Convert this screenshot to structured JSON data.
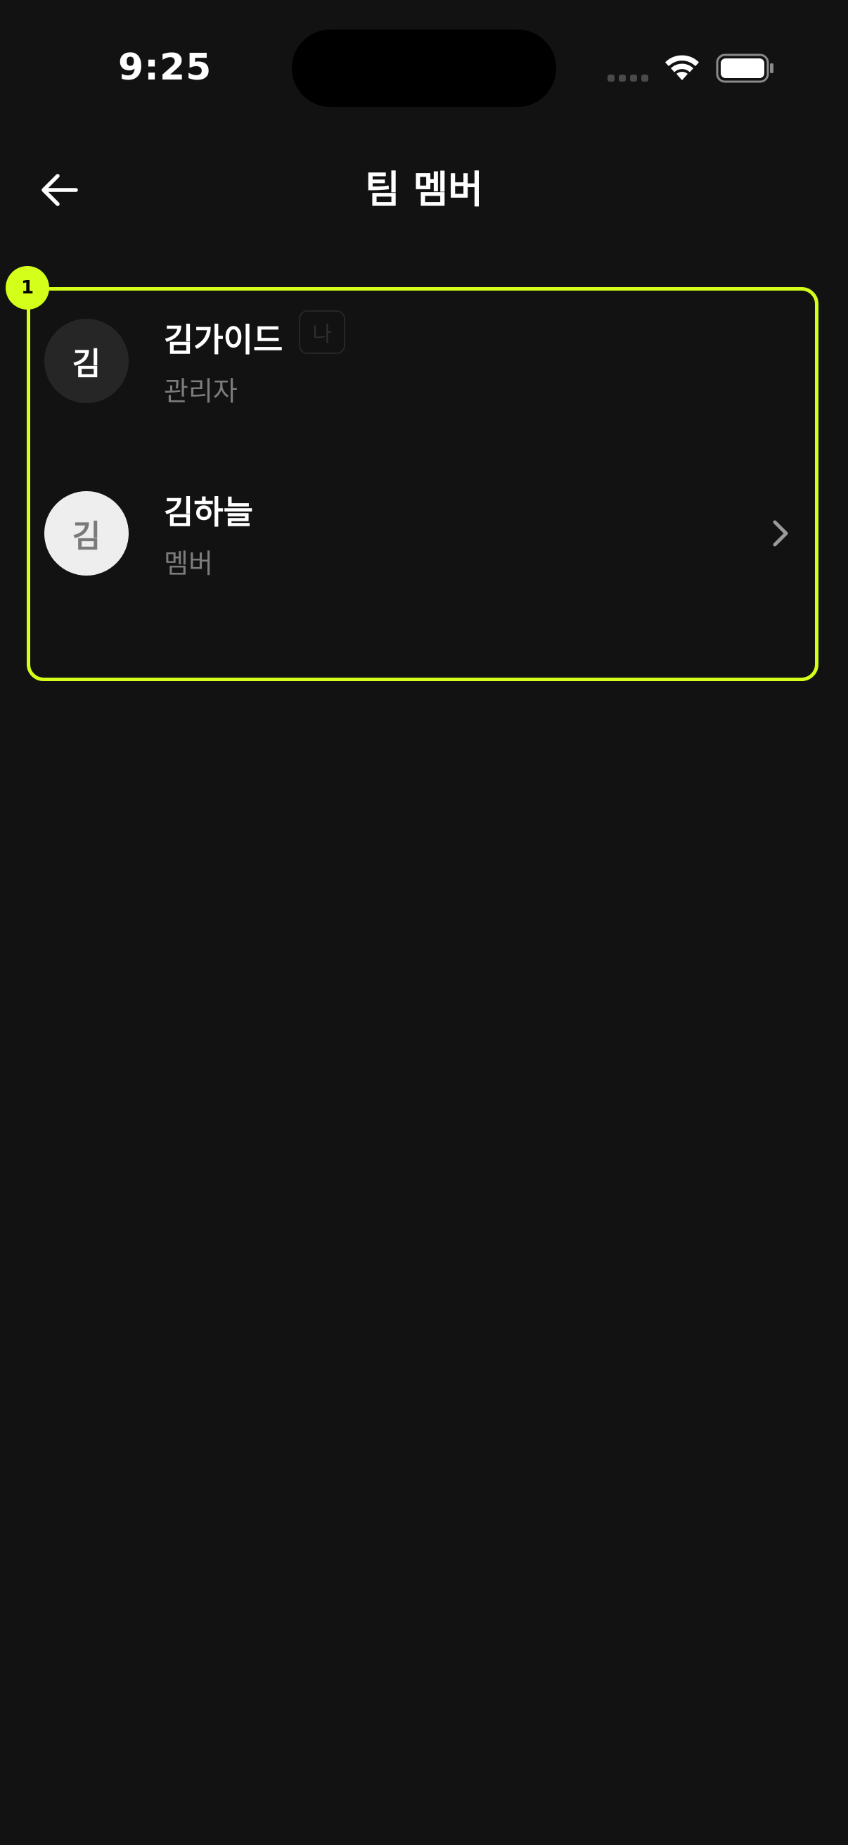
{
  "status_bar": {
    "time": "9:25",
    "icons": [
      "signal-dots-icon",
      "wifi-icon",
      "battery-icon"
    ]
  },
  "header": {
    "title": "팀 멤버",
    "back_icon": "arrow-left-icon"
  },
  "annotation": {
    "marker": "1",
    "color": "#d4ff1a"
  },
  "members": [
    {
      "avatar_initial": "김",
      "name": "김가이드",
      "self_badge": "나",
      "role": "관리자"
    },
    {
      "avatar_initial": "김",
      "name": "김하늘",
      "role": "멤버",
      "trailing_icon": "chevron-right-icon"
    }
  ],
  "colors": {
    "background": "#121212",
    "accent": "#d4ff1a",
    "text_primary": "#ffffff",
    "text_secondary": "#7c7c7c"
  }
}
